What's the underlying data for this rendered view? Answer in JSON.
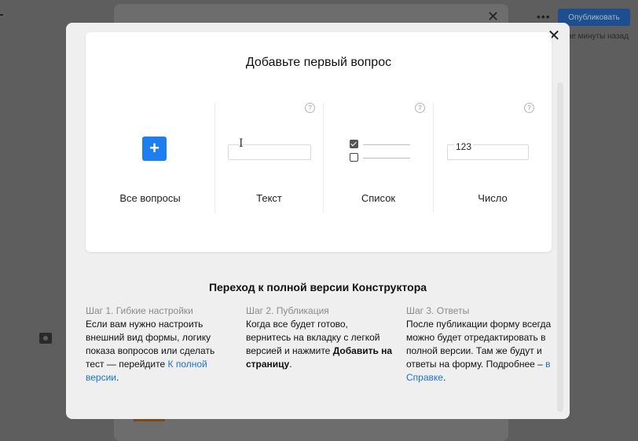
{
  "background": {
    "publish_button": "Опубликовать",
    "saved_status": "ве минуты назад",
    "close_glyph": "✕",
    "menu_glyph": "•••"
  },
  "modal": {
    "close_glyph": "✕",
    "card_title": "Добавьте первый вопрос",
    "help_glyph": "?",
    "question_types": [
      {
        "label": "Все вопросы",
        "icon": "plus-icon",
        "glyph": "+"
      },
      {
        "label": "Текст",
        "icon": "text-input-icon",
        "glyph": "I"
      },
      {
        "label": "Список",
        "icon": "checkbox-list-icon"
      },
      {
        "label": "Число",
        "icon": "number-input-icon",
        "glyph": "123"
      }
    ],
    "section_title": "Переход к полной версии Конструктора",
    "steps": [
      {
        "head": "Шаг 1. Гибкие настройки",
        "body": "Если вам нужно настроить внешний вид формы, логику показа вопросов или сделать тест — перейдите ",
        "link": "К полной версии",
        "tail": "."
      },
      {
        "head": "Шаг 2. Публикация",
        "body": "Когда все будет готово, вернитесь на вкладку с легкой версией и нажмите ",
        "bold": "Добавить на страницу",
        "tail": "."
      },
      {
        "head": "Шаг 3. Ответы",
        "body": "После публикации форму всегда можно будет отредактировать в полной версии. Там же будут и ответы на форму. Подробнее – ",
        "link": "в Справке",
        "tail": "."
      }
    ]
  },
  "colors": {
    "accent": "#1e7ef0",
    "link": "#1a73c9",
    "overlay": "#5e5e5e"
  }
}
